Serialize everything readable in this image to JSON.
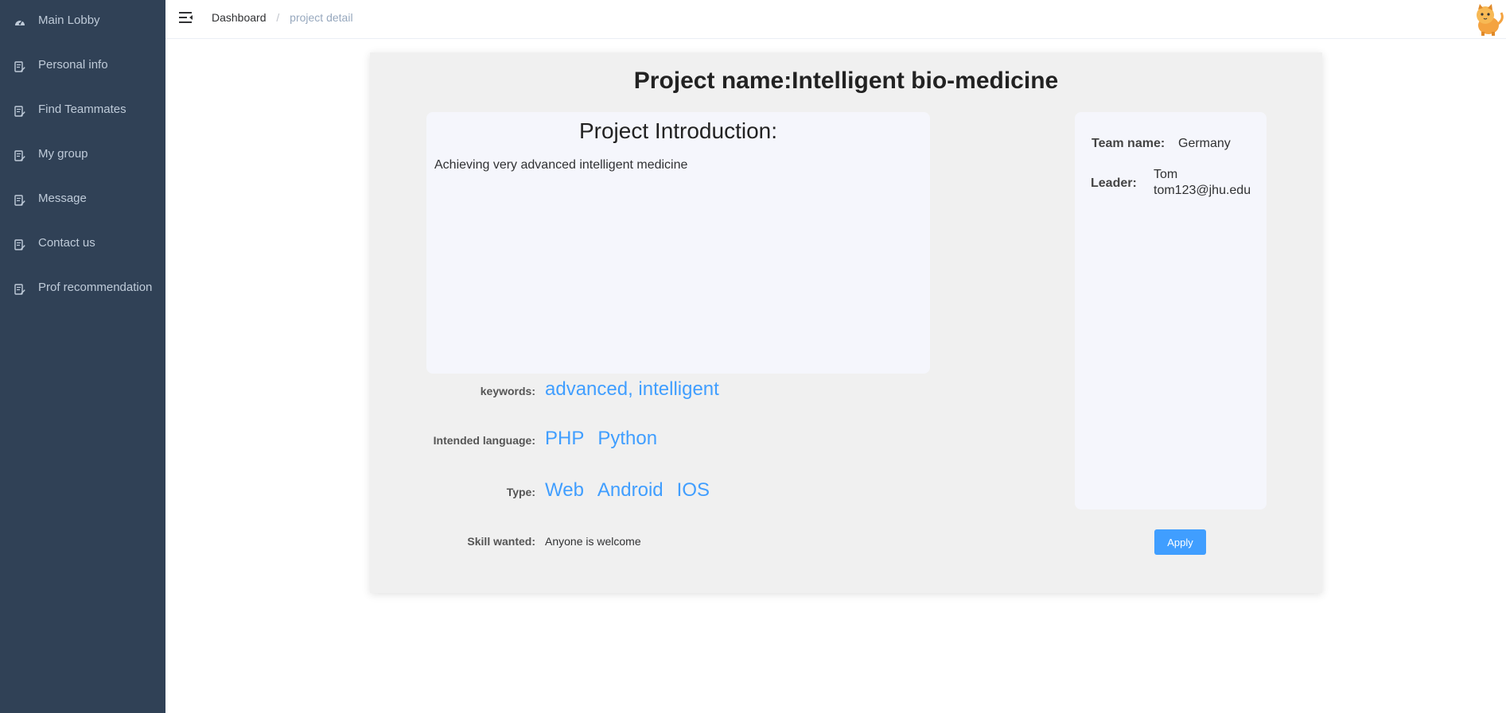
{
  "sidebar": {
    "items": [
      {
        "label": "Main Lobby",
        "icon": "dashboard-icon"
      },
      {
        "label": "Personal info",
        "icon": "form-icon"
      },
      {
        "label": "Find Teammates",
        "icon": "form-icon"
      },
      {
        "label": "My group",
        "icon": "form-icon"
      },
      {
        "label": "Message",
        "icon": "form-icon"
      },
      {
        "label": "Contact us",
        "icon": "form-icon"
      },
      {
        "label": "Prof recommendation",
        "icon": "form-icon"
      }
    ]
  },
  "topbar": {
    "breadcrumb": {
      "root": "Dashboard",
      "separator": "/",
      "current": "project detail"
    }
  },
  "project": {
    "title": "Project name:Intelligent bio-medicine",
    "intro_heading": "Project Introduction:",
    "intro_text": "Achieving very advanced intelligent medicine",
    "keywords_label": "keywords:",
    "keywords": "advanced, intelligent",
    "language_label": "Intended language:",
    "languages": [
      "PHP",
      "Python"
    ],
    "type_label": "Type:",
    "types": [
      "Web",
      "Android",
      "IOS"
    ],
    "skill_label": "Skill wanted:",
    "skill": "Anyone is welcome"
  },
  "team": {
    "name_label": "Team name:",
    "name": "Germany",
    "leader_label": "Leader:",
    "leader_name": "Tom",
    "leader_email": "tom123@jhu.edu"
  },
  "actions": {
    "apply_label": "Apply"
  },
  "colors": {
    "sidebar_bg": "#304156",
    "accent": "#409eff",
    "card_bg": "#f0f0f0"
  }
}
